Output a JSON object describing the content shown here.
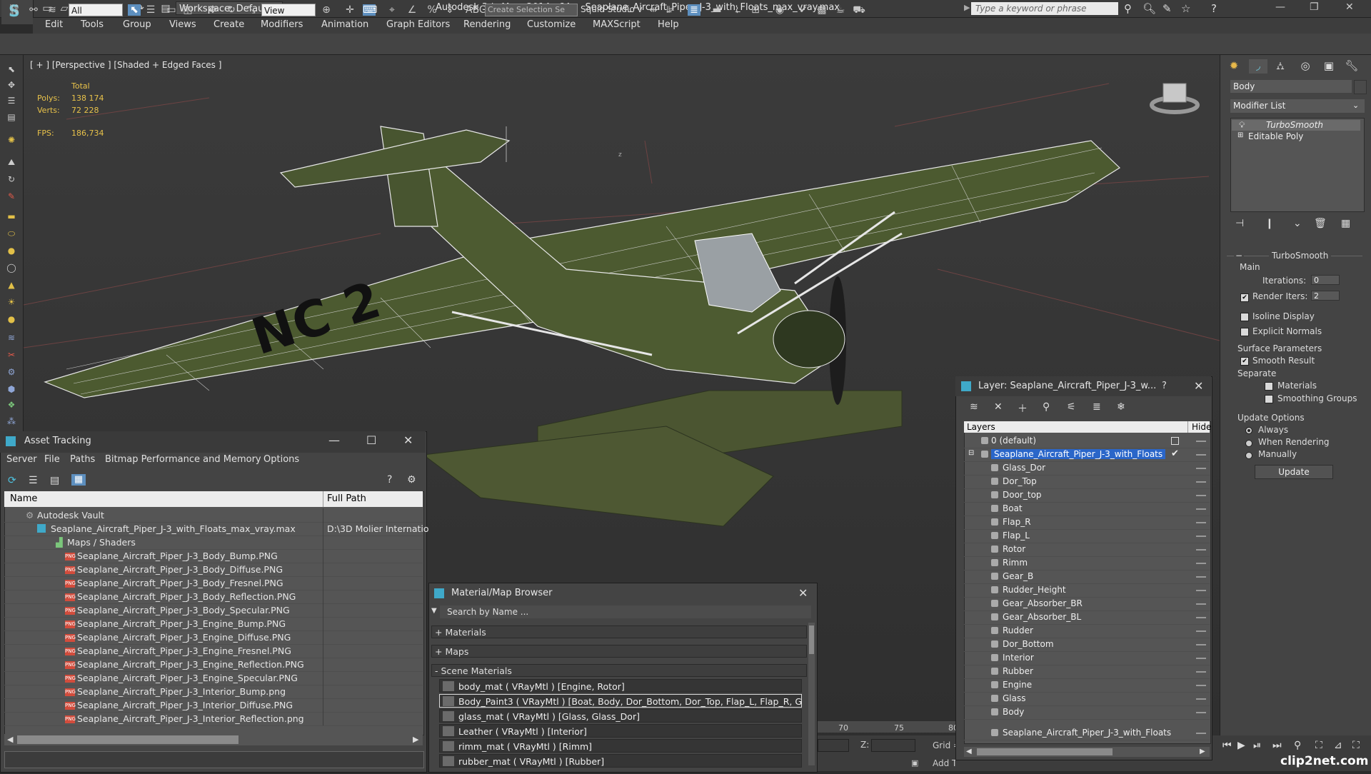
{
  "titlebar": {
    "workspace": "Workspace: Default",
    "title": "Autodesk 3ds Max  2014 x64     Seaplane_Aircraft_Piper_J-3_with_Floats_max_vray.max",
    "search_placeholder": "Type a keyword or phrase"
  },
  "menu": [
    "Edit",
    "Tools",
    "Group",
    "Views",
    "Create",
    "Modifiers",
    "Animation",
    "Graph Editors",
    "Rendering",
    "Customize",
    "MAXScript",
    "Help"
  ],
  "toolbar": {
    "filter": "All",
    "refcoord": "View",
    "selection_set": "Create Selection Se",
    "squid": "Squid Studio v"
  },
  "viewport": {
    "label": "[ + ] [Perspective ] [Shaded + Edged Faces ]",
    "stats": {
      "total_label": "Total",
      "polys_label": "Polys:",
      "polys": "138 174",
      "verts_label": "Verts:",
      "verts": "72 228",
      "fps_label": "FPS:",
      "fps": "186,734"
    },
    "axis_z": "z"
  },
  "right_panel": {
    "object_name": "Body",
    "modifier_list": "Modifier List",
    "stack": [
      "TurboSmooth",
      "Editable Poly"
    ],
    "rollout_title": "TurboSmooth",
    "main_label": "Main",
    "iterations_label": "Iterations:",
    "iterations": "0",
    "render_iters_label": "Render Iters:",
    "render_iters": "2",
    "isoline": "Isoline Display",
    "explicit_normals": "Explicit Normals",
    "surface_params": "Surface Parameters",
    "smooth_result": "Smooth Result",
    "separate": "Separate",
    "materials": "Materials",
    "smoothing_groups": "Smoothing Groups",
    "update_options": "Update Options",
    "always": "Always",
    "when_rendering": "When Rendering",
    "manually": "Manually",
    "update_btn": "Update"
  },
  "asset_tracking": {
    "title": "Asset Tracking",
    "menu": [
      "Server",
      "File",
      "Paths",
      "Bitmap Performance and Memory",
      "Options"
    ],
    "col_name": "Name",
    "col_path": "Full Path",
    "vault": "Autodesk Vault",
    "max_file": "Seaplane_Aircraft_Piper_J-3_with_Floats_max_vray.max",
    "max_path": "D:\\3D Molier Internatio",
    "maps_folder": "Maps / Shaders",
    "files": [
      "Seaplane_Aircraft_Piper_J-3_Body_Bump.PNG",
      "Seaplane_Aircraft_Piper_J-3_Body_Diffuse.PNG",
      "Seaplane_Aircraft_Piper_J-3_Body_Fresnel.PNG",
      "Seaplane_Aircraft_Piper_J-3_Body_Reflection.PNG",
      "Seaplane_Aircraft_Piper_J-3_Body_Specular.PNG",
      "Seaplane_Aircraft_Piper_J-3_Engine_Bump.PNG",
      "Seaplane_Aircraft_Piper_J-3_Engine_Diffuse.PNG",
      "Seaplane_Aircraft_Piper_J-3_Engine_Fresnel.PNG",
      "Seaplane_Aircraft_Piper_J-3_Engine_Reflection.PNG",
      "Seaplane_Aircraft_Piper_J-3_Engine_Specular.PNG",
      "Seaplane_Aircraft_Piper_J-3_Interior_Bump.png",
      "Seaplane_Aircraft_Piper_J-3_Interior_Diffuse.PNG",
      "Seaplane_Aircraft_Piper_J-3_Interior_Reflection.png"
    ]
  },
  "material_browser": {
    "title": "Material/Map Browser",
    "search": "Search by Name ...",
    "sections": [
      "+ Materials",
      "+ Maps",
      "- Scene Materials"
    ],
    "materials": [
      "body_mat  ( VRayMtl ) [Engine, Rotor]",
      "Body_Paint3  ( VRayMtl ) [Boat, Body, Dor_Bottom, Dor_Top, Flap_L, Flap_R, G...",
      "glass_mat  ( VRayMtl ) [Glass, Glass_Dor]",
      "Leather  ( VRayMtl ) [Interior]",
      "rimm_mat  ( VRayMtl ) [Rimm]",
      "rubber_mat  ( VRayMtl ) [Rubber]"
    ]
  },
  "layer_dialog": {
    "title": "Layer: Seaplane_Aircraft_Piper_J-3_w...",
    "help": "?",
    "col_layers": "Layers",
    "col_hide": "Hide",
    "default_layer": "0 (default)",
    "active_layer": "Seaplane_Aircraft_Piper_J-3_with_Floats",
    "objects": [
      "Glass_Dor",
      "Dor_Top",
      "Door_top",
      "Boat",
      "Flap_R",
      "Flap_L",
      "Rotor",
      "Rimm",
      "Gear_B",
      "Rudder_Height",
      "Gear_Absorber_BR",
      "Gear_Absorber_BL",
      "Rudder",
      "Dor_Bottom",
      "Interior",
      "Rubber",
      "Engine",
      "Glass",
      "Body",
      "Seaplane_Aircraft_Piper_J-3_with_Floats"
    ]
  },
  "timeline": {
    "ticks": [
      "70",
      "75",
      "80"
    ],
    "z_label": "Z:",
    "grid_label": "Grid =",
    "add_t": "Add T"
  },
  "watermark": "clip2net.com"
}
